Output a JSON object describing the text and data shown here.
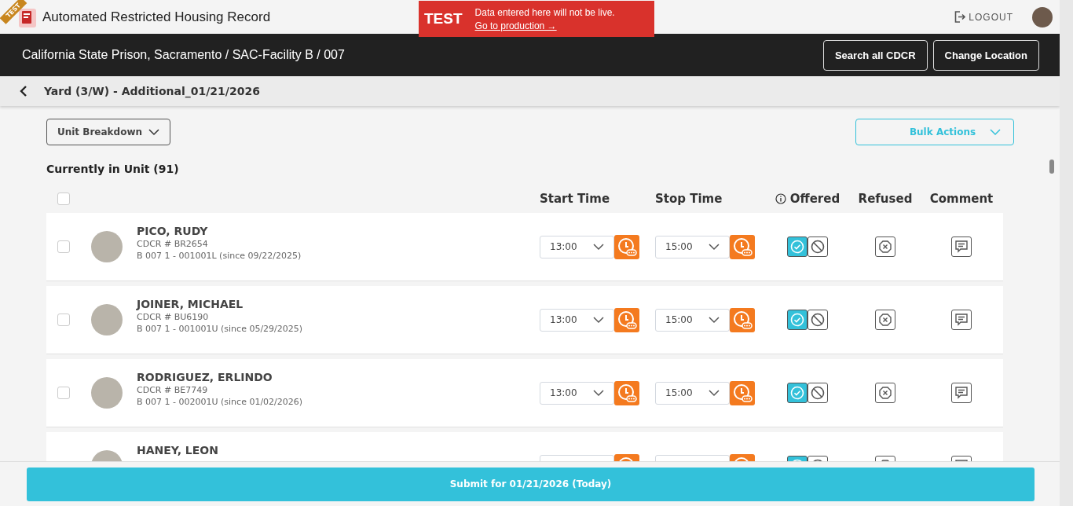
{
  "app": {
    "title": "Automated Restricted Housing Record",
    "ribbon": "TEST"
  },
  "test_banner": {
    "label": "TEST",
    "message": "Data entered here will not be live.",
    "link": "Go to production →"
  },
  "user_menu": {
    "logout": "LOGOUT"
  },
  "location_bar": {
    "path": "California State Prison, Sacramento / SAC-Facility B / 007",
    "buttons": [
      "Search all CDCR",
      "Change Location"
    ]
  },
  "page_header": {
    "title": "Yard (3/W) - Additional_01/21/2026"
  },
  "toolbar": {
    "unit_breakdown": "Unit Breakdown",
    "bulk_actions": "Bulk Actions"
  },
  "section_title": "Currently in Unit (91)",
  "table": {
    "select_all_checked": false,
    "columns": [
      "Start Time",
      "Stop Time",
      "Offered",
      "Refused",
      "Comment"
    ],
    "rows": [
      {
        "name": "PICO, RUDY",
        "cdcr": "CDCR # BR2654",
        "location": "B 007 1 - 001001L (since 09/22/2025)",
        "checked": false,
        "start": "13:00",
        "stop": "15:00",
        "offered": true,
        "not_offered": false,
        "refused": false
      },
      {
        "name": "JOINER, MICHAEL",
        "cdcr": "CDCR # BU6190",
        "location": "B 007 1 - 001001U (since 05/29/2025)",
        "checked": false,
        "start": "13:00",
        "stop": "15:00",
        "offered": true,
        "not_offered": false,
        "refused": false
      },
      {
        "name": "RODRIGUEZ, ERLINDO",
        "cdcr": "CDCR # BE7749",
        "location": "B 007 1 - 002001U (since 01/02/2026)",
        "checked": false,
        "start": "13:00",
        "stop": "15:00",
        "offered": true,
        "not_offered": false,
        "refused": false
      },
      {
        "name": "HANEY, LEON",
        "offered": true,
        "not_offered": false,
        "refused": false
      }
    ]
  },
  "submit_button": "Submit for 01/21/2026 (Today)"
}
